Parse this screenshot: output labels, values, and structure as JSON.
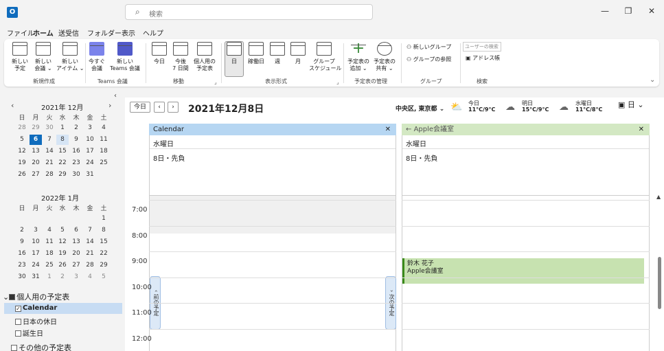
{
  "search": {
    "placeholder": "検索"
  },
  "menu": [
    "ファイル",
    "ホーム",
    "送受信",
    "フォルダー",
    "表示",
    "ヘルプ"
  ],
  "ribbon": {
    "new": [
      {
        "label": "新しい\n予定"
      },
      {
        "label": "新しい\n会議 ⌄"
      },
      {
        "label": "新しい\nアイテム ⌄"
      }
    ],
    "new_group": "新規作成",
    "teams": [
      {
        "label": "今すぐ\n会議"
      },
      {
        "label": "新しい\nTeams 会議"
      }
    ],
    "teams_group": "Teams 会議",
    "goto": [
      {
        "label": "今日"
      },
      {
        "label": "今後\n7 日間"
      },
      {
        "label": "個人用の\n予定表"
      }
    ],
    "goto_group": "移動",
    "view": [
      {
        "label": "日"
      },
      {
        "label": "稼働日"
      },
      {
        "label": "週"
      },
      {
        "label": "月"
      },
      {
        "label": "グループ\nスケジュール"
      }
    ],
    "view_group": "表示形式",
    "manage": [
      {
        "label": "予定表の\n追加 ⌄"
      },
      {
        "label": "予定表の\n共有 ⌄"
      }
    ],
    "manage_group": "予定表の管理",
    "groups": {
      "new": "新しいグループ",
      "browse": "グループの参照",
      "label": "グループ"
    },
    "find": {
      "placeholder": "ユーザーの検索",
      "addressbook": "アドレス帳",
      "label": "検索"
    }
  },
  "minical": {
    "dec": {
      "title": "2021年 12月",
      "dow": [
        "日",
        "月",
        "火",
        "水",
        "木",
        "金",
        "土"
      ],
      "weeks": [
        [
          "28",
          "29",
          "30",
          "1",
          "2",
          "3",
          "4"
        ],
        [
          "5",
          "6",
          "7",
          "8",
          "9",
          "10",
          "11"
        ],
        [
          "12",
          "13",
          "14",
          "15",
          "16",
          "17",
          "18"
        ],
        [
          "19",
          "20",
          "21",
          "22",
          "23",
          "24",
          "25"
        ],
        [
          "26",
          "27",
          "28",
          "29",
          "30",
          "31",
          ""
        ]
      ]
    },
    "jan": {
      "title": "2022年 1月",
      "dow": [
        "日",
        "月",
        "火",
        "水",
        "木",
        "金",
        "土"
      ],
      "weeks": [
        [
          "",
          "",
          "",
          "",
          "",
          "",
          "1"
        ],
        [
          "2",
          "3",
          "4",
          "5",
          "6",
          "7",
          "8"
        ],
        [
          "9",
          "10",
          "11",
          "12",
          "13",
          "14",
          "15"
        ],
        [
          "16",
          "17",
          "18",
          "19",
          "20",
          "21",
          "22"
        ],
        [
          "23",
          "24",
          "25",
          "26",
          "27",
          "28",
          "29"
        ],
        [
          "30",
          "31",
          "1",
          "2",
          "3",
          "4",
          "5"
        ]
      ]
    }
  },
  "folders": {
    "group": "個人用の予定表",
    "items": [
      "Calendar",
      "日本の休日",
      "誕生日"
    ],
    "other": "その他の予定表"
  },
  "toolbar": {
    "today": "今日",
    "prev": "‹",
    "next": "›",
    "date": "2021年12月8日",
    "location": "中央区, 東京都",
    "view": "日"
  },
  "weather": [
    {
      "day": "今日",
      "temp": "11°C/9°C"
    },
    {
      "day": "明日",
      "temp": "15°C/9°C"
    },
    {
      "day": "水曜日",
      "temp": "11°C/8°C"
    }
  ],
  "columns": [
    {
      "title": "Calendar",
      "weekday": "水曜日",
      "sub": "8日・先負"
    },
    {
      "title": "Apple会議室",
      "weekday": "水曜日",
      "sub": "8日・先負"
    }
  ],
  "times": [
    "7:00",
    "8:00",
    "9:00",
    "10:00",
    "11:00",
    "12:00"
  ],
  "event": {
    "line1": "鈴木 花子",
    "line2": "Apple会議室"
  },
  "tabs": {
    "prev": "前の予定",
    "next": "次の予定"
  },
  "colors": {
    "accent": "#0f6cbd",
    "cal1": "#b6d6f2",
    "cal2": "#d3e8c3",
    "event": "#c7e2b0"
  }
}
